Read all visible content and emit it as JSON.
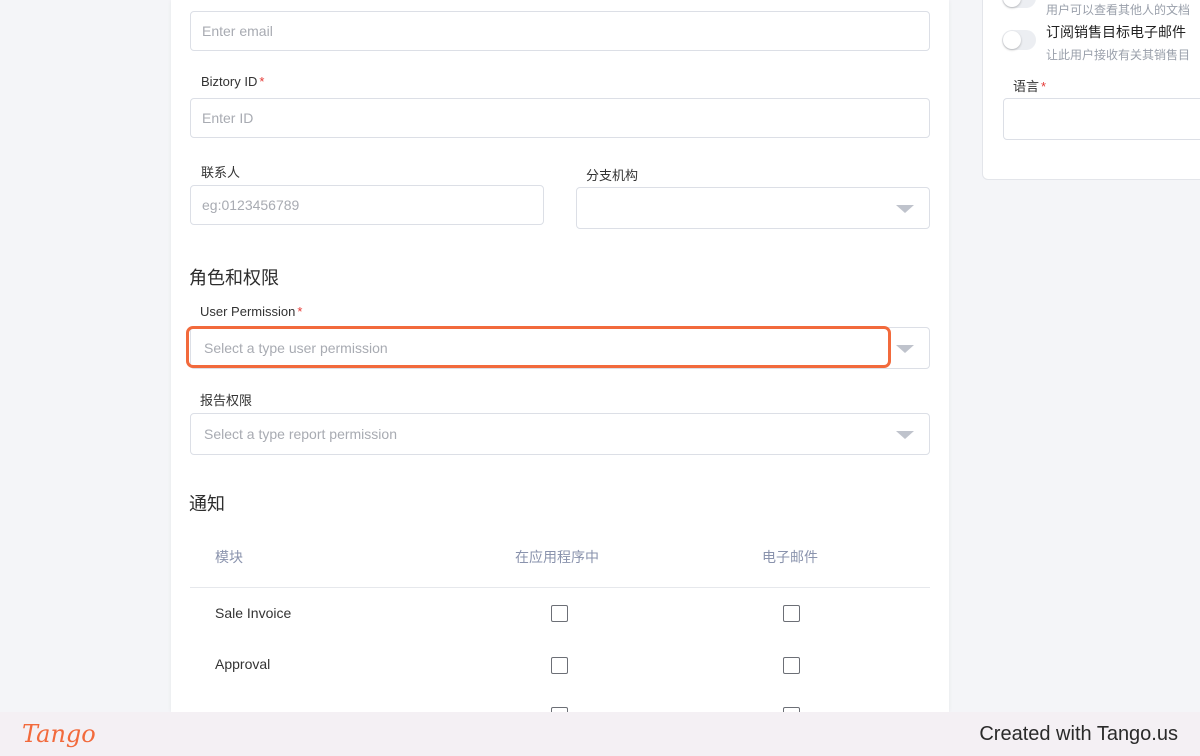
{
  "form": {
    "email": {
      "placeholder": "Enter email"
    },
    "biztory_id": {
      "label": "Biztory ID",
      "placeholder": "Enter ID"
    },
    "contact": {
      "label": "联系人",
      "placeholder": "eg:0123456789"
    },
    "branch": {
      "label": "分支机构",
      "value": ""
    },
    "roles_section": "角色和权限",
    "user_permission": {
      "label": "User Permission",
      "placeholder": "Select a type user permission"
    },
    "report_permission": {
      "label": "报告权限",
      "placeholder": "Select a type report permission"
    },
    "required_mark": "*"
  },
  "notifications": {
    "title": "通知",
    "columns": [
      "模块",
      "在应用程序中",
      "电子邮件"
    ],
    "rows": [
      {
        "module": "Sale Invoice",
        "in_app": false,
        "email": false
      },
      {
        "module": "Approval",
        "in_app": false,
        "email": false
      }
    ]
  },
  "side": {
    "toggle1_sub": "用户可以查看其他人的文档",
    "toggle2_title": "订阅销售目标电子邮件",
    "toggle2_sub": "让此用户接收有关其销售目",
    "language": {
      "label": "语言"
    }
  },
  "footer": {
    "brand": "Tango",
    "credit": "Created with Tango.us"
  },
  "colors": {
    "highlight": "#f26a3c",
    "required": "#e53935"
  }
}
